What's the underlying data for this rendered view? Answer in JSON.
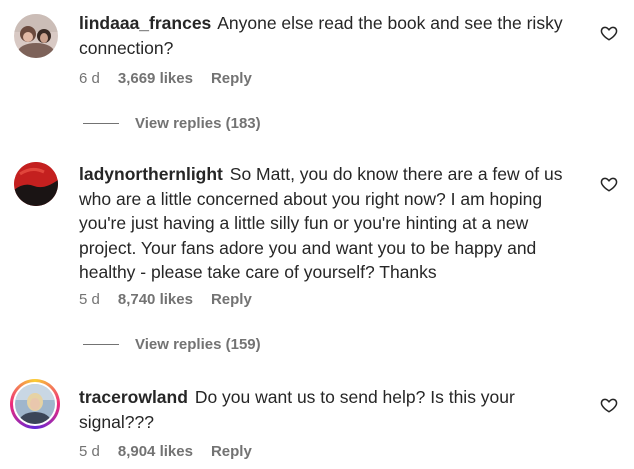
{
  "comments": [
    {
      "username": "lindaaa_frances",
      "text": "Anyone else read the book and see the risky connection?",
      "time": "6 d",
      "likes": "3,669 likes",
      "reply_label": "Reply",
      "view_replies": "View replies (183)",
      "heart_icon": "heart-outline-icon"
    },
    {
      "username": "ladynorthernlight",
      "text": "So Matt, you do know there are a few of us who are a little concerned about you right now? I am hoping you're just having a little silly fun or you're hinting at a new project. Your fans adore you and want you to be happy and healthy - please take care of yourself? Thanks",
      "time": "5 d",
      "likes": "8,740 likes",
      "reply_label": "Reply",
      "view_replies": "View replies (159)",
      "heart_icon": "heart-outline-icon"
    },
    {
      "username": "tracerowland",
      "text": "Do you want us to send help? Is this your signal???",
      "time": "5 d",
      "likes": "8,904 likes",
      "reply_label": "Reply",
      "heart_icon": "heart-outline-icon"
    }
  ]
}
